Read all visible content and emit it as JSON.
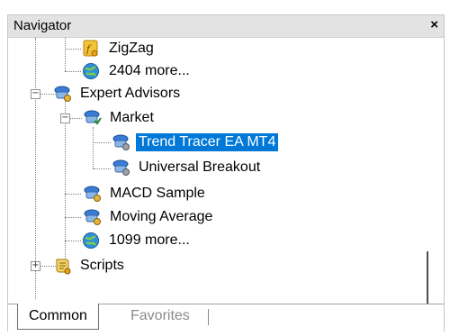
{
  "window": {
    "title": "Navigator",
    "close_label": "×"
  },
  "tree": {
    "items": [
      {
        "label": "ZigZag",
        "icon": "indicator-icon"
      },
      {
        "label": "2404 more...",
        "icon": "globe-icon"
      },
      {
        "label": "Expert Advisors",
        "icon": "expert-advisor-icon"
      },
      {
        "label": "Market",
        "icon": "market-icon"
      },
      {
        "label": "Trend Tracer EA MT4",
        "icon": "expert-advisor-icon",
        "selected": true
      },
      {
        "label": "Universal Breakout",
        "icon": "expert-advisor-icon"
      },
      {
        "label": "MACD Sample",
        "icon": "expert-advisor-icon"
      },
      {
        "label": "Moving Average",
        "icon": "expert-advisor-icon"
      },
      {
        "label": "1099 more...",
        "icon": "globe-icon"
      },
      {
        "label": "Scripts",
        "icon": "scripts-icon"
      }
    ],
    "expand_signs": {
      "collapse": "−",
      "expand": "+"
    }
  },
  "tabs": [
    {
      "label": "Common",
      "active": true
    },
    {
      "label": "Favorites",
      "active": false
    }
  ],
  "colors": {
    "selection": "#0078d7",
    "title_bar": "#e3e3e3"
  }
}
